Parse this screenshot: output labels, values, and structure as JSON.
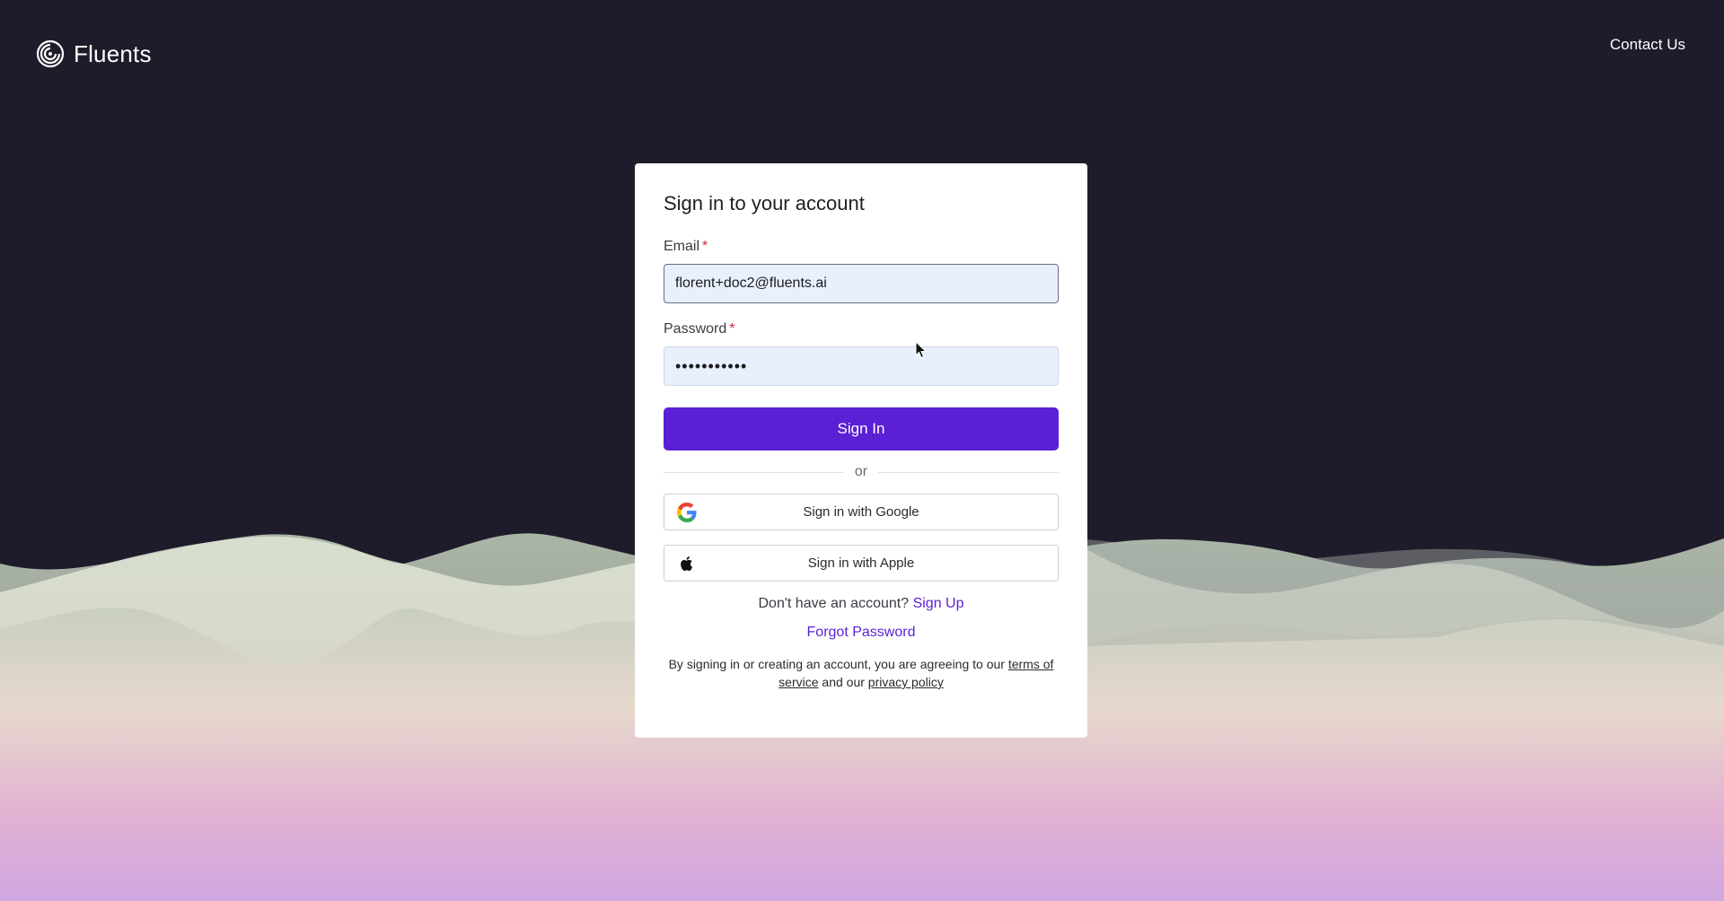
{
  "header": {
    "brand": "Fluents",
    "contact_label": "Contact Us"
  },
  "signin": {
    "title": "Sign in to your account",
    "email_label": "Email",
    "email_required": "*",
    "email_value": "florent+doc2@fluents.ai",
    "password_label": "Password",
    "password_required": "*",
    "password_value": "•••••••••••",
    "submit_label": "Sign In",
    "divider_text": "or",
    "google_label": "Sign in with Google",
    "apple_label": "Sign in with Apple",
    "signup_prompt": "Don't have an account?",
    "signup_link": "Sign Up",
    "forgot_link": "Forgot Password",
    "legal_prefix": "By signing in or creating an account, you are agreeing to our",
    "terms_link": "terms of service",
    "legal_middle": "and our",
    "privacy_link": "privacy policy"
  },
  "colors": {
    "background": "#1e1c2a",
    "accent": "#5b1fd5",
    "input_bg": "#e8f0fe"
  },
  "icons": {
    "logo": "fluents-spiral-icon",
    "google": "google-g-icon",
    "apple": "apple-icon"
  }
}
